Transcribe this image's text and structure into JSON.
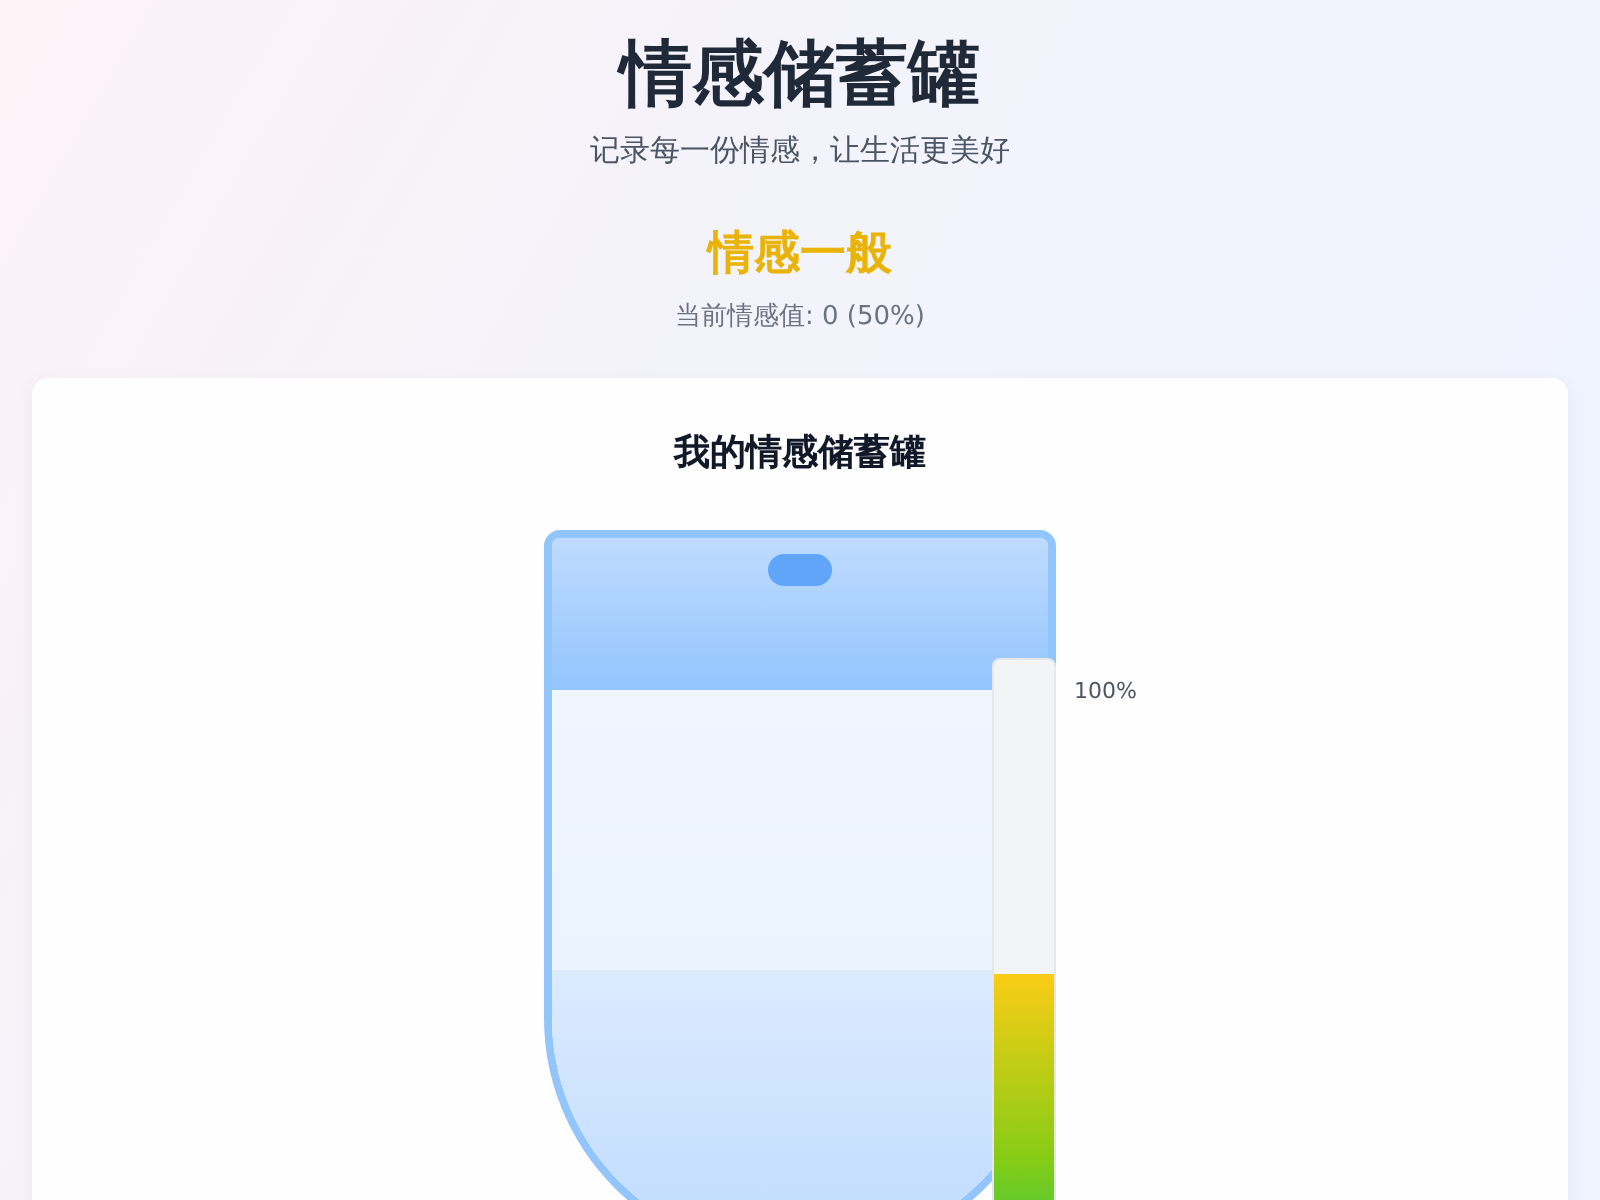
{
  "header": {
    "title": "情感储蓄罐",
    "subtitle": "记录每一份情感，让生活更美好"
  },
  "mood": {
    "label": "情感一般",
    "reading": "当前情感值: 0 (50%)"
  },
  "card": {
    "title": "我的情感储蓄罐",
    "jar": {
      "level": 0.5
    },
    "meter": {
      "level": 0.5,
      "top_label": "100%"
    }
  }
}
